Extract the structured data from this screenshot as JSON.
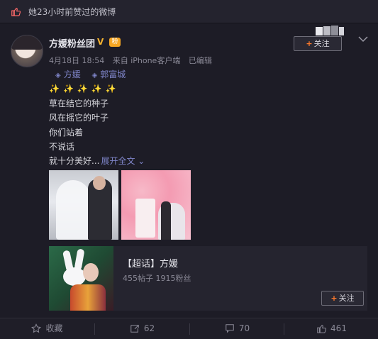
{
  "top_bar": {
    "label": "她23小时前赞过的微博"
  },
  "post": {
    "author": "方媛粉丝团",
    "vip_badge": "V",
    "fan_badge": "粉",
    "date": "4月18日 18:54",
    "source": "来自 iPhone客户端",
    "edited": "已编辑",
    "follow_label": "关注",
    "tags": [
      "方媛",
      "郭富城"
    ],
    "stars": "✨✨✨✨✨",
    "lines": [
      "草在结它的种子",
      "风在摇它的叶子",
      "你们站着",
      "不说话",
      "就十分美好..."
    ],
    "expand_label": "展开全文"
  },
  "topic_card": {
    "title": "【超话】方媛",
    "stats": "455帖子 1915粉丝",
    "follow_label": "关注"
  },
  "actions": {
    "favorite": "收藏",
    "repost": "62",
    "comment": "70",
    "like": "461"
  },
  "colors": {
    "accent": "#ff7a2b",
    "link": "#7f85c9",
    "background": "#1d1c26"
  }
}
